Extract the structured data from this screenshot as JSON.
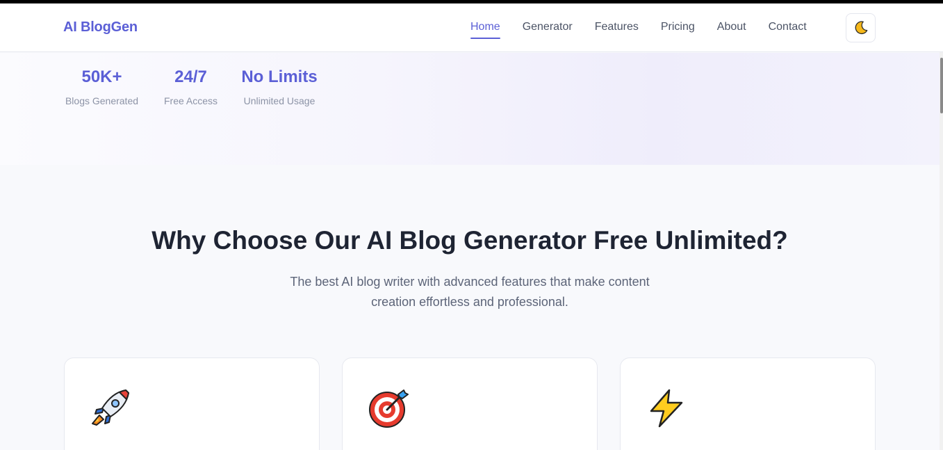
{
  "navbar": {
    "logo": "AI BlogGen",
    "links": [
      {
        "label": "Home",
        "active": true
      },
      {
        "label": "Generator"
      },
      {
        "label": "Features"
      },
      {
        "label": "Pricing"
      },
      {
        "label": "About"
      },
      {
        "label": "Contact"
      }
    ],
    "theme_toggle_icon": "moon-icon"
  },
  "hero": {
    "stats": [
      {
        "value": "50K+",
        "label": "Blogs Generated"
      },
      {
        "value": "24/7",
        "label": "Free Access"
      },
      {
        "value": "No Limits",
        "label": "Unlimited Usage"
      }
    ]
  },
  "features": {
    "title": "Why Choose Our AI Blog Generator Free Unlimited?",
    "subtitle": "The best AI blog writer with advanced features that make content creation effortless and professional.",
    "cards": [
      {
        "icon": "rocket-icon"
      },
      {
        "icon": "target-icon"
      },
      {
        "icon": "lightning-icon"
      }
    ]
  },
  "colors": {
    "accent": "#5b5fd6",
    "heading": "#1e2433",
    "muted": "#8c93a6"
  }
}
